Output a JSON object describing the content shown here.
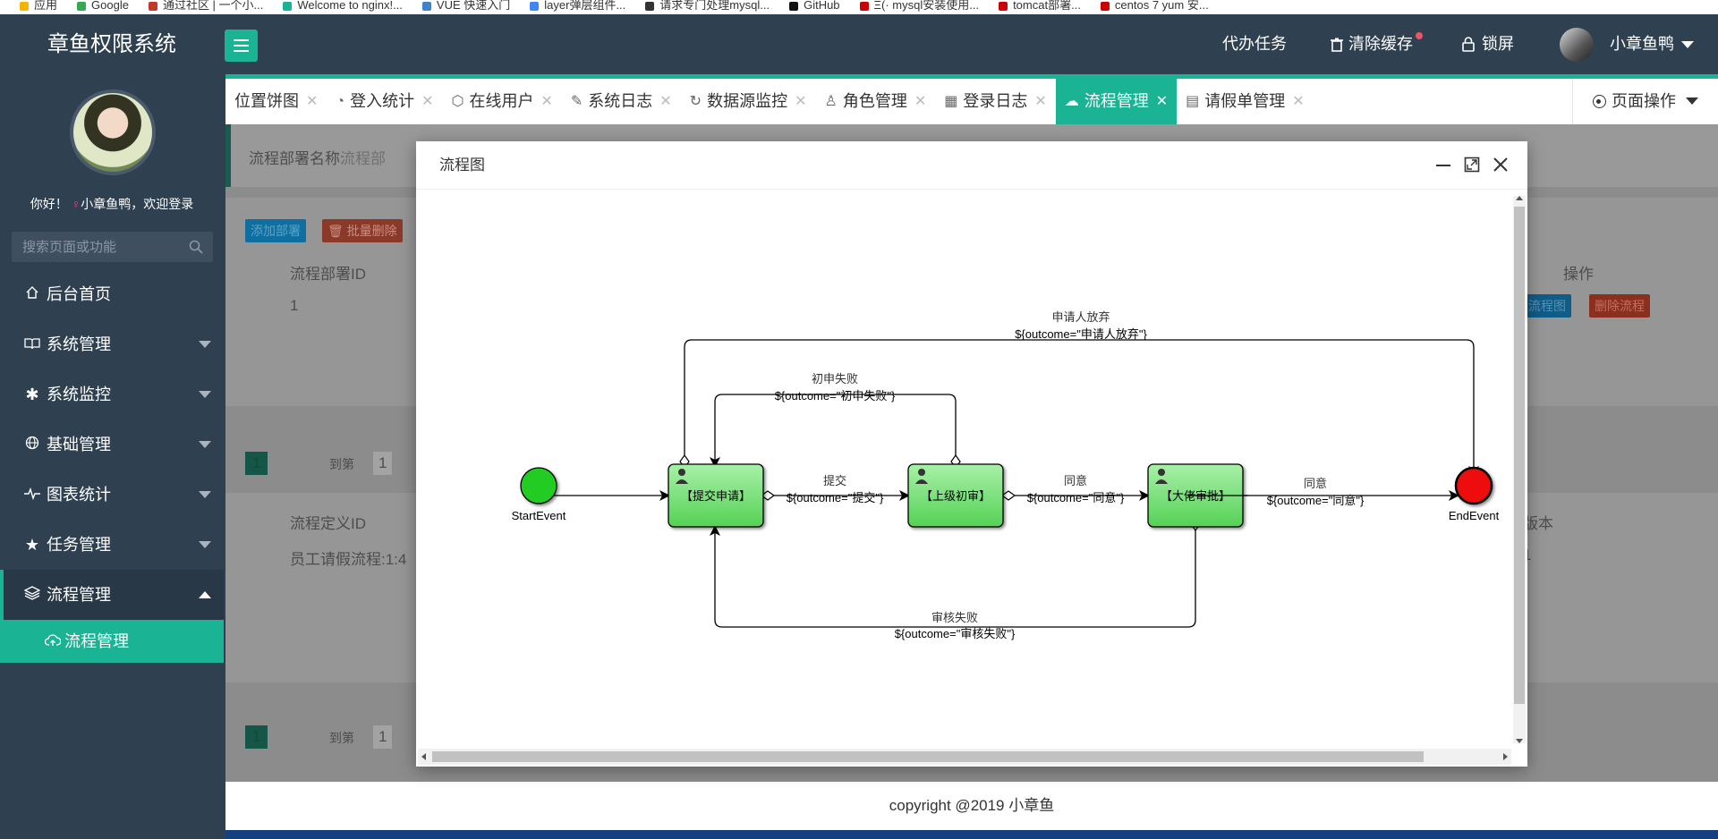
{
  "browser_bookmarks": [
    "应用",
    "Google",
    "通过社区 | 一个小...",
    "Welcome to nginx!...",
    "VUE 快速入门",
    "layer弹层组件...",
    "请求专门处理mysql...",
    "GitHub",
    "Ξ(· mysql安装使用...",
    "tomcat部署...",
    "centos 7 yum 安..."
  ],
  "app": {
    "title": "章鱼权限系统"
  },
  "topbar": {
    "agent_tasks": "代办任务",
    "clear_cache": "清除缓存",
    "lock": "锁屏",
    "user": "小章鱼鸭"
  },
  "sidebar": {
    "welcome_prefix": "你好！",
    "welcome_user": "小章鱼鸭，欢迎登录",
    "search_placeholder": "搜索页面或功能",
    "items": [
      {
        "label": "后台首页",
        "icon": "home-icon"
      },
      {
        "label": "系统管理",
        "icon": "book-icon"
      },
      {
        "label": "系统监控",
        "icon": "gear-icon"
      },
      {
        "label": "基础管理",
        "icon": "globe-icon"
      },
      {
        "label": "图表统计",
        "icon": "pulse-icon"
      },
      {
        "label": "任务管理",
        "icon": "star-icon"
      },
      {
        "label": "流程管理",
        "icon": "layers-icon"
      }
    ],
    "sub_item": {
      "label": "流程管理",
      "icon": "cloud-upload-icon"
    }
  },
  "tabs": [
    {
      "label": "位置饼图",
      "icon": ""
    },
    {
      "label": "登入统计",
      "icon": "palette-icon"
    },
    {
      "label": "在线用户",
      "icon": "cube-icon"
    },
    {
      "label": "系统日志",
      "icon": "edit-doc-icon"
    },
    {
      "label": "数据源监控",
      "icon": "sync-icon"
    },
    {
      "label": "角色管理",
      "icon": "user-icon"
    },
    {
      "label": "登录日志",
      "icon": "table-icon"
    },
    {
      "label": "流程管理",
      "icon": "cloud-upload-icon",
      "active": true
    },
    {
      "label": "请假单管理",
      "icon": "calendar-icon"
    }
  ],
  "page_ops": "页面操作",
  "background_page": {
    "deploy_name_label": "流程部署名称:",
    "deploy_name_placeholder": "流程部",
    "add_deploy": "添加部署",
    "batch_delete": "批量删除",
    "col_deploy_id": "流程部署ID",
    "col_ops": "操作",
    "row1_id": "1",
    "btn_flowchart": "流程图",
    "btn_delete_flow": "删除流程",
    "pager_page": "1",
    "pager_goto": "到第",
    "pager_input": "1",
    "col_def_id": "流程定义ID",
    "col_version": "版本",
    "row2_def": "员工请假流程:1:4",
    "row2_version": "1",
    "pager2_page": "1",
    "pager2_goto": "到第",
    "pager2_input": "1"
  },
  "modal": {
    "title": "流程图"
  },
  "diagram": {
    "start_event": "StartEvent",
    "end_event": "EndEvent",
    "tasks": [
      "【提交申请】",
      "【上级初审】",
      "【大佬审批】"
    ],
    "flows": [
      {
        "label": "提交",
        "expr": "${outcome=\"提交\"}"
      },
      {
        "label": "同意",
        "expr": "${outcome=\"同意\"}"
      },
      {
        "label": "同意",
        "expr": "${outcome=\"同意\"}"
      },
      {
        "label": "初申失败",
        "expr": "${outcome=\"初申失败\"}"
      },
      {
        "label": "申请人放弃",
        "expr": "${outcome=\"申请人放弃\"}"
      },
      {
        "label": "审核失败",
        "expr": "${outcome=\"审核失败\"}"
      }
    ],
    "colors": {
      "start": "#22cc22",
      "end": "#ee1111",
      "task_top": "#a8f0a8",
      "task_bottom": "#55d155"
    }
  },
  "footer": "copyright @2019 小章鱼"
}
